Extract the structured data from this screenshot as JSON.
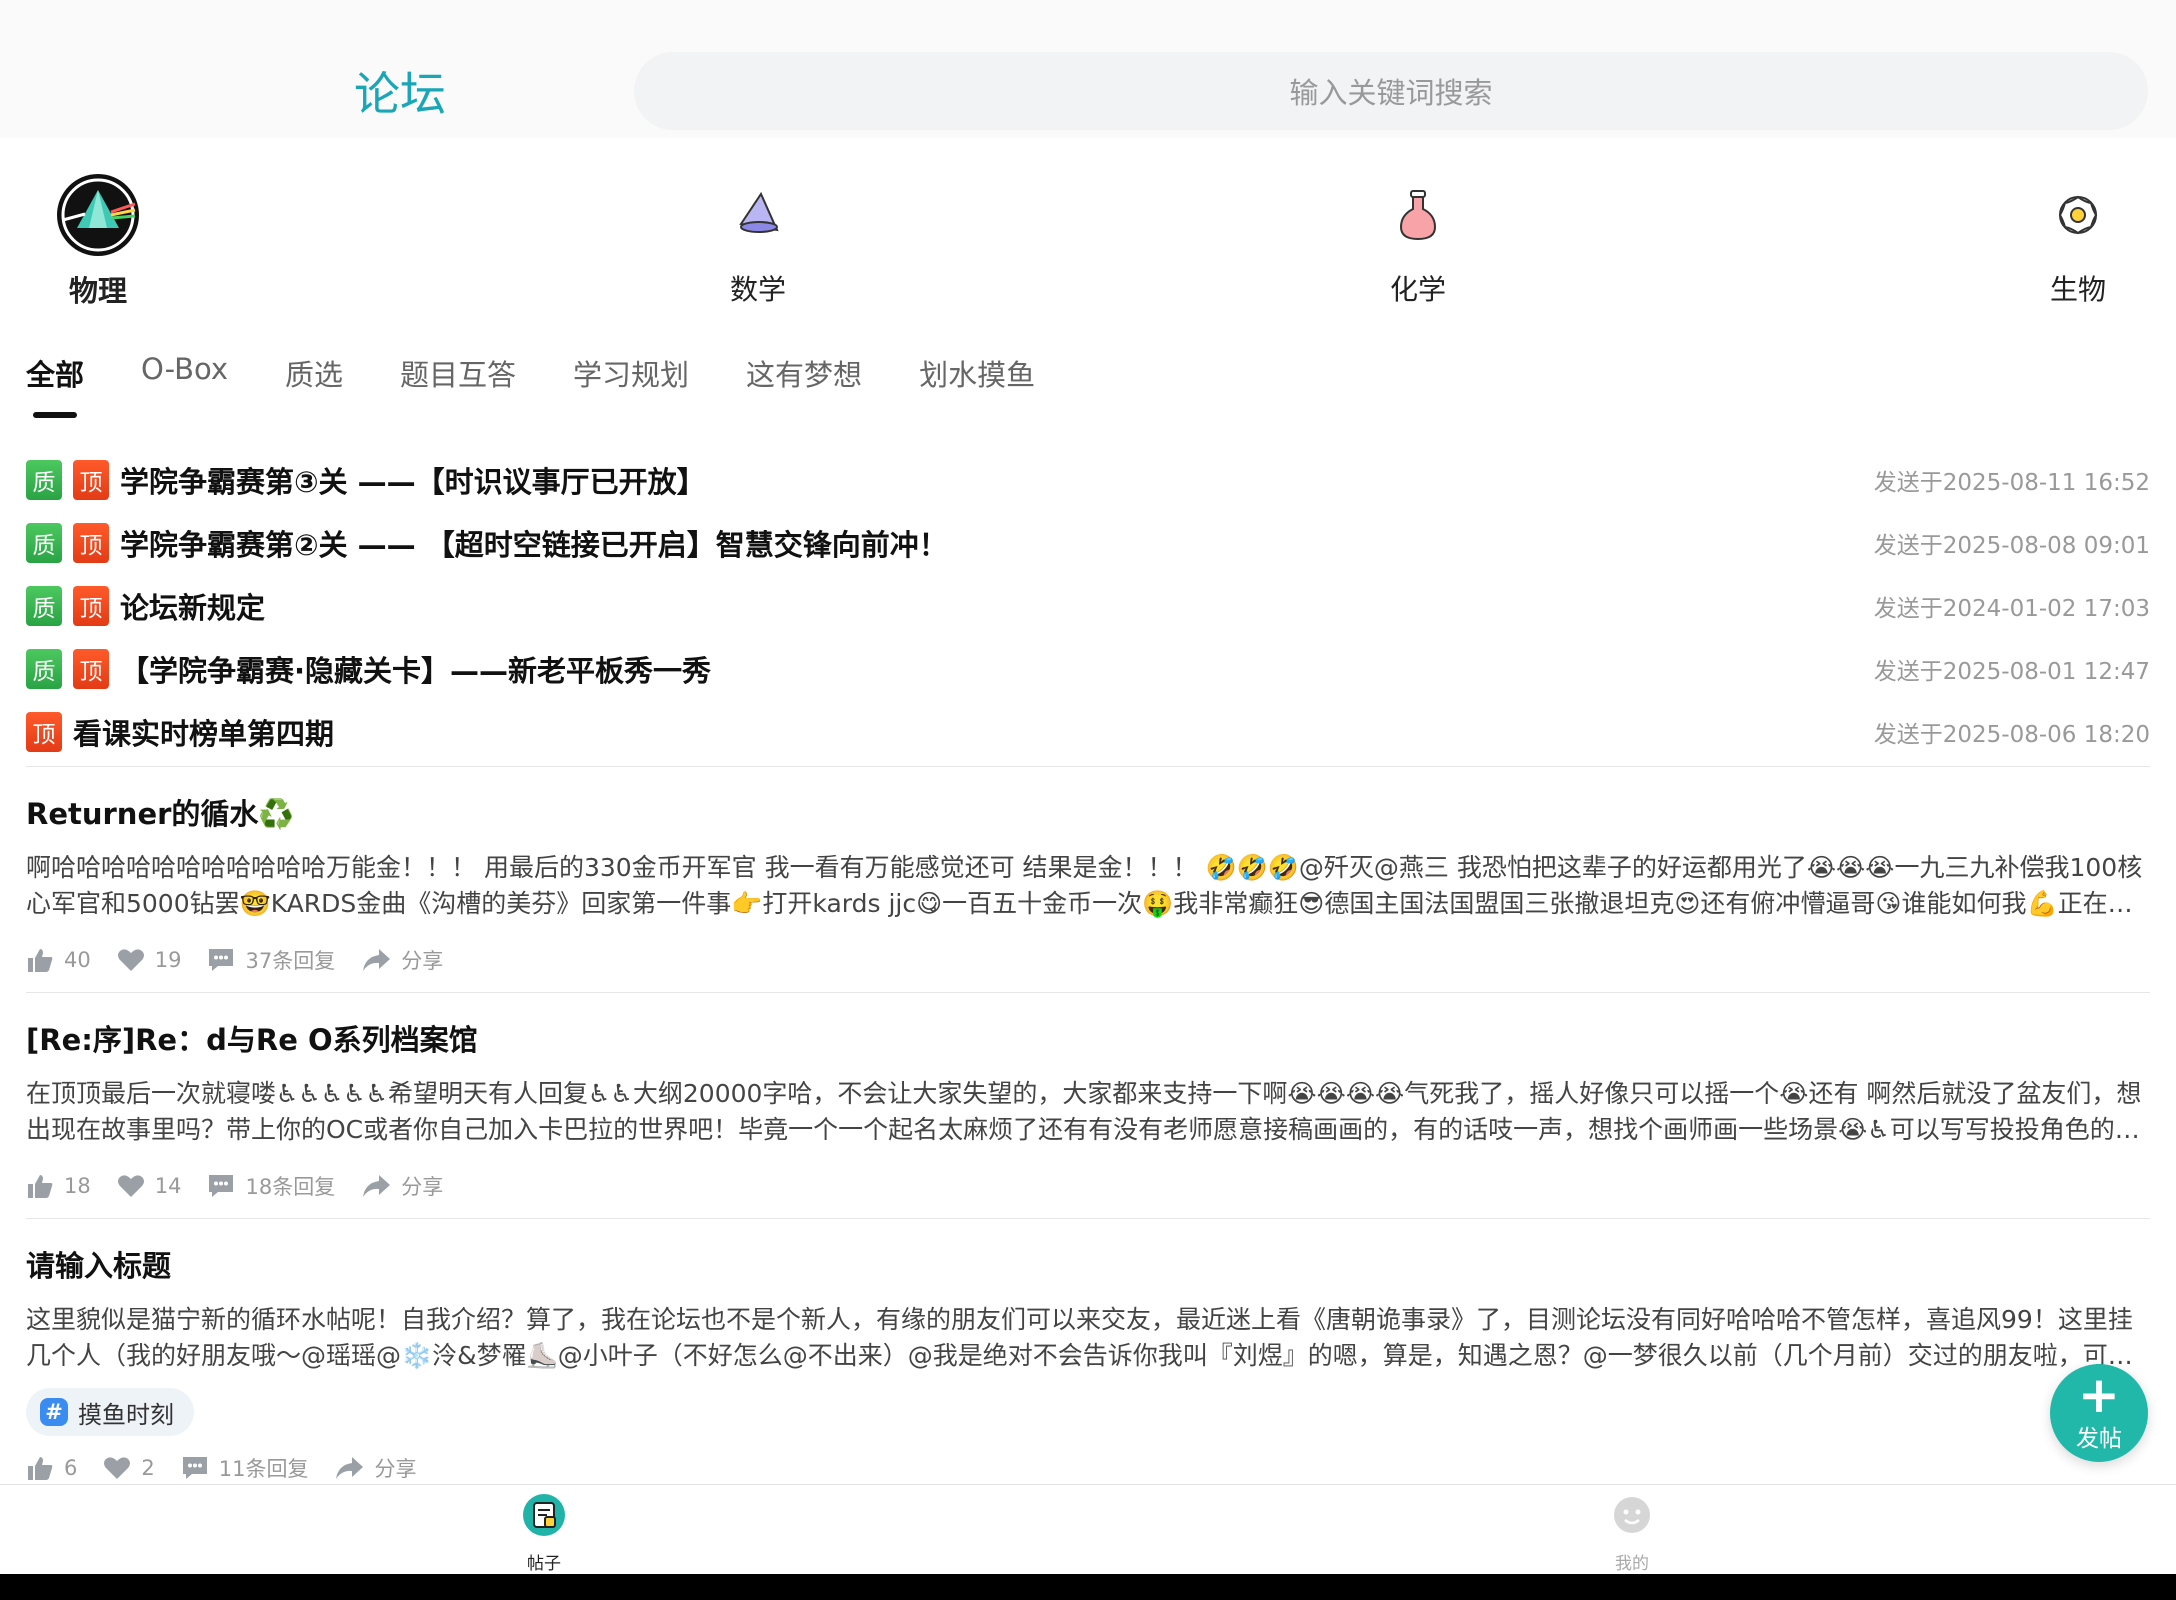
{
  "header": {
    "title": "论坛",
    "search_placeholder": "输入关键词搜索"
  },
  "subjects": [
    {
      "label": "物理",
      "icon": "prism-icon",
      "active": true
    },
    {
      "label": "数学",
      "icon": "cone-icon",
      "active": false
    },
    {
      "label": "化学",
      "icon": "flask-icon",
      "active": false
    },
    {
      "label": "生物",
      "icon": "flower-icon",
      "active": false
    }
  ],
  "tabs": [
    "全部",
    "O-Box",
    "质选",
    "题目互答",
    "学习规划",
    "这有梦想",
    "划水摸鱼"
  ],
  "badges": {
    "quality": "质",
    "top": "顶"
  },
  "pinned": [
    {
      "title": "学院争霸赛第③关 ——【时识议事厅已开放】",
      "time": "发送于2025-08-11 16:52",
      "quality": true
    },
    {
      "title": "学院争霸赛第②关 —— 【超时空链接已开启】智慧交锋向前冲！",
      "time": "发送于2025-08-08 09:01",
      "quality": true
    },
    {
      "title": "论坛新规定",
      "time": "发送于2024-01-02 17:03",
      "quality": true
    },
    {
      "title": "【学院争霸赛·隐藏关卡】——新老平板秀一秀",
      "time": "发送于2025-08-01 12:47",
      "quality": true
    },
    {
      "title": "看课实时榜单第四期",
      "time": "发送于2025-08-06 18:20",
      "quality": false
    }
  ],
  "posts": [
    {
      "title": "Returner的循水♻️",
      "body": "啊哈哈哈哈哈哈哈哈哈哈哈万能金！！！ 用最后的330金币开军官 我一看有万能感觉还可 结果是金！！！ 🤣🤣🤣@歼灭@燕三 我恐怕把这辈子的好运都用光了😭😭😭一九三九补偿我100核心军官和5000钻罢🤓KARDS金曲《沟槽的美芬》回家第一件事👉打开kards jjc😋一百五十金币一次🤑我非常癫狂😎德国主国法国盟国三张撤退坦克😍还有俯冲懵逼哥😘谁能如何我💪正在寻找敌…",
      "likes": "40",
      "hearts": "19",
      "replies": "37条回复",
      "share": "分享"
    },
    {
      "title": "[Re:序]Re：d与Re O系列档案馆",
      "body": "在顶顶最后一次就寝喽♿♿♿♿♿希望明天有人回复♿♿大纲20000字哈，不会让大家失望的，大家都来支持一下啊😭😭😭😭气死我了，摇人好像只可以摇一个😭还有 啊然后就没了盆友们，想出现在故事里吗？带上你的OC或者你自己加入卡巴拉的世界吧！毕竟一个一个起名太麻烦了还有有没有老师愿意接稿画画的，有的话吱一声，想找个画师画一些场景😭♿可以写写投投角色的…",
      "likes": "18",
      "hearts": "14",
      "replies": "18条回复",
      "share": "分享"
    },
    {
      "title": "请输入标题",
      "body": "这里貌似是猫宁新的循环水帖呢！自我介绍？算了，我在论坛也不是个新人，有缘的朋友们可以来交友，最近迷上看《唐朝诡事录》了，目测论坛没有同好哈哈哈不管怎样，喜追风99！这里挂几个人（我的好朋友哦～@瑶瑶@❄️泠&梦罹⛸️@小叶子（不好怎么@不出来）@我是绝对不会告诉你我叫『刘煜』的嗯，算是，知遇之恩？@一梦很久以前（几个月前）交过的朋友啦，可是曾经的红…",
      "tag": "摸鱼时刻",
      "likes": "6",
      "hearts": "2",
      "replies": "11条回复",
      "share": "分享"
    }
  ],
  "fab": {
    "label": "发帖"
  },
  "bottom_nav": [
    {
      "label": "帖子",
      "active": true
    },
    {
      "label": "我的",
      "active": false
    }
  ],
  "colors": {
    "accent": "#1aa6b7",
    "fab": "#21b8aa",
    "quality_badge": "#2aa345",
    "top_badge": "#e33b16"
  }
}
